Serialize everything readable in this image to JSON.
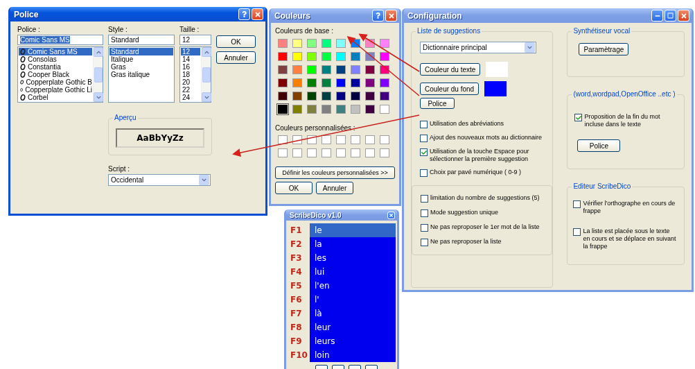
{
  "police_dialog": {
    "title": "Police",
    "active": true,
    "font_label": "Police :",
    "font_value": "Comic Sans MS",
    "fonts": [
      {
        "name": "Comic Sans MS",
        "selected": true
      },
      {
        "name": "Consolas",
        "selected": false
      },
      {
        "name": "Constantia",
        "selected": false
      },
      {
        "name": "Cooper Black",
        "selected": false
      },
      {
        "name": "Copperplate Gothic B",
        "selected": false
      },
      {
        "name": "Copperplate Gothic Li",
        "selected": false
      },
      {
        "name": "Corbel",
        "selected": false
      }
    ],
    "style_label": "Style :",
    "style_value": "Standard",
    "styles": [
      {
        "name": "Standard",
        "selected": true
      },
      {
        "name": "Italique",
        "selected": false
      },
      {
        "name": "Gras",
        "selected": false
      },
      {
        "name": "Gras italique",
        "selected": false
      }
    ],
    "size_label": "Taille :",
    "size_value": "12",
    "sizes": [
      {
        "name": "12",
        "selected": true
      },
      {
        "name": "14",
        "selected": false
      },
      {
        "name": "16",
        "selected": false
      },
      {
        "name": "18",
        "selected": false
      },
      {
        "name": "20",
        "selected": false
      },
      {
        "name": "22",
        "selected": false
      },
      {
        "name": "24",
        "selected": false
      }
    ],
    "buttons": [
      "OK",
      "Annuler"
    ],
    "preview_label": "Aperçu",
    "preview_text": "AaBbYyZz",
    "script_label": "Script :",
    "script_value": "Occidental"
  },
  "colors_dialog": {
    "title": "Couleurs",
    "active": false,
    "basic_label": "Couleurs de base :",
    "basic_colors": [
      {
        "color": "#ff8080",
        "selected": false
      },
      {
        "color": "#ffff80",
        "selected": false
      },
      {
        "color": "#80ff80",
        "selected": false
      },
      {
        "color": "#00ff80",
        "selected": false
      },
      {
        "color": "#80ffff",
        "selected": false
      },
      {
        "color": "#0080ff",
        "selected": false
      },
      {
        "color": "#ff80c0",
        "selected": false
      },
      {
        "color": "#ff80ff",
        "selected": false
      },
      {
        "color": "#ff0000",
        "selected": false
      },
      {
        "color": "#ffff00",
        "selected": false
      },
      {
        "color": "#80ff00",
        "selected": false
      },
      {
        "color": "#00ff40",
        "selected": false
      },
      {
        "color": "#00ffff",
        "selected": false
      },
      {
        "color": "#0080c0",
        "selected": false
      },
      {
        "color": "#8080c0",
        "selected": false
      },
      {
        "color": "#ff00ff",
        "selected": false
      },
      {
        "color": "#804040",
        "selected": false
      },
      {
        "color": "#ff8040",
        "selected": false
      },
      {
        "color": "#00ff00",
        "selected": false
      },
      {
        "color": "#008080",
        "selected": false
      },
      {
        "color": "#004080",
        "selected": false
      },
      {
        "color": "#8080ff",
        "selected": false
      },
      {
        "color": "#800040",
        "selected": false
      },
      {
        "color": "#ff0080",
        "selected": false
      },
      {
        "color": "#800000",
        "selected": false
      },
      {
        "color": "#ff8000",
        "selected": false
      },
      {
        "color": "#008000",
        "selected": false
      },
      {
        "color": "#008040",
        "selected": false
      },
      {
        "color": "#0000ff",
        "selected": false
      },
      {
        "color": "#0000a0",
        "selected": false
      },
      {
        "color": "#800080",
        "selected": false
      },
      {
        "color": "#8000ff",
        "selected": false
      },
      {
        "color": "#400000",
        "selected": false
      },
      {
        "color": "#804000",
        "selected": false
      },
      {
        "color": "#004000",
        "selected": false
      },
      {
        "color": "#004040",
        "selected": false
      },
      {
        "color": "#000080",
        "selected": false
      },
      {
        "color": "#000040",
        "selected": false
      },
      {
        "color": "#400040",
        "selected": false
      },
      {
        "color": "#400080",
        "selected": false
      },
      {
        "color": "#000000",
        "selected": true
      },
      {
        "color": "#808000",
        "selected": false
      },
      {
        "color": "#808040",
        "selected": false
      },
      {
        "color": "#808080",
        "selected": false
      },
      {
        "color": "#408080",
        "selected": false
      },
      {
        "color": "#c0c0c0",
        "selected": false
      },
      {
        "color": "#400040",
        "selected": false
      },
      {
        "color": "#ffffff",
        "selected": false
      }
    ],
    "custom_label": "Couleurs personnalisées :",
    "custom_colors": [
      {
        "color": "#ffffff"
      },
      {
        "color": "#ffffff"
      },
      {
        "color": "#ffffff"
      },
      {
        "color": "#ffffff"
      },
      {
        "color": "#ffffff"
      },
      {
        "color": "#ffffff"
      },
      {
        "color": "#ffffff"
      },
      {
        "color": "#ffffff"
      },
      {
        "color": "#ffffff"
      },
      {
        "color": "#ffffff"
      },
      {
        "color": "#ffffff"
      },
      {
        "color": "#ffffff"
      },
      {
        "color": "#ffffff"
      },
      {
        "color": "#ffffff"
      },
      {
        "color": "#ffffff"
      },
      {
        "color": "#ffffff"
      }
    ],
    "define_button": "Définir les couleurs personnalisées >>",
    "buttons": [
      "OK",
      "Annuler"
    ]
  },
  "config_window": {
    "title": "Configuration",
    "active": false,
    "suggestions_group": {
      "title": "Liste de suggestions",
      "dictionary": "Dictionnaire principal",
      "text_color_button": "Couleur du texte",
      "background_color_button": "Couleur du fond",
      "color_previews": [
        {
          "color": "#ffffff"
        },
        {
          "color": "#0000ff"
        }
      ],
      "font_button": "Police",
      "options": [
        {
          "label": "Utilisation des abréviations",
          "checked": false
        },
        {
          "label": "Ajout des nouveaux mots au dictionnaire",
          "checked": false
        },
        {
          "label": "Utilisation de  la  touche Espace pour sélectionner la première suggestion",
          "checked": true
        },
        {
          "label": "Choix par pavé numérique ( 0-9 )",
          "checked": false
        }
      ],
      "limit_options": [
        {
          "label": "limitation du  nombre de suggestions (5)",
          "checked": false
        },
        {
          "label": "Mode suggestion unique",
          "checked": false
        },
        {
          "label": "Ne pas reproposer le 1er mot de la liste",
          "checked": false
        },
        {
          "label": "Ne pas reproposer la liste",
          "checked": false
        }
      ]
    },
    "voice_group": {
      "title": "Synthétiseur vocal",
      "button": "Paramètrage"
    },
    "office_group": {
      "title": "(word,wordpad,OpenOffice ..etc )",
      "option": {
        "label": "Proposition de la fin  du mot incluse dans le texte",
        "checked": true
      },
      "button": "Police"
    },
    "editor_group": {
      "title": "Editeur ScribeDico",
      "options": [
        {
          "label": "Vérifier l'orthographe en cours de frappe",
          "checked": false
        },
        {
          "label": "La liste est placée sous le texte en cours et se déplace en suivant la frappe",
          "checked": false
        }
      ]
    }
  },
  "scribedico_window": {
    "title": "ScribeDico v1.0",
    "active": false,
    "suggestions": [
      {
        "key": "F1",
        "word": "le",
        "selected": true
      },
      {
        "key": "F2",
        "word": "la",
        "selected": false
      },
      {
        "key": "F3",
        "word": "les",
        "selected": false
      },
      {
        "key": "F4",
        "word": "lui",
        "selected": false
      },
      {
        "key": "F5",
        "word": "l'en",
        "selected": false
      },
      {
        "key": "F6",
        "word": "l'",
        "selected": false
      },
      {
        "key": "F7",
        "word": "là",
        "selected": false
      },
      {
        "key": "F8",
        "word": "leur",
        "selected": false
      },
      {
        "key": "F9",
        "word": "leurs",
        "selected": false
      },
      {
        "key": "F10",
        "word": "loin",
        "selected": false
      }
    ]
  }
}
